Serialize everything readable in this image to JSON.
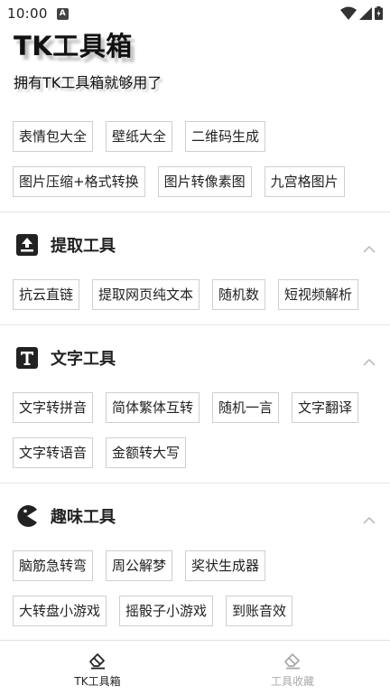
{
  "status_bar": {
    "time": "10:00",
    "notification_badge": "A"
  },
  "header": {
    "title": "TK工具箱",
    "subtitle": "拥有TK工具箱就够用了"
  },
  "top_tools": [
    {
      "label": "表情包大全"
    },
    {
      "label": "壁纸大全"
    },
    {
      "label": "二维码生成"
    },
    {
      "label": "图片压缩+格式转换"
    },
    {
      "label": "图片转像素图"
    },
    {
      "label": "九宫格图片"
    }
  ],
  "sections": [
    {
      "title": "提取工具",
      "icon": "upload-box-icon",
      "tools": [
        {
          "label": "抗云直链"
        },
        {
          "label": "提取网页纯文本"
        },
        {
          "label": "随机数"
        },
        {
          "label": "短视频解析"
        }
      ]
    },
    {
      "title": "文字工具",
      "icon": "text-box-icon",
      "tools": [
        {
          "label": "文字转拼音"
        },
        {
          "label": "简体繁体互转"
        },
        {
          "label": "随机一言"
        },
        {
          "label": "文字翻译"
        },
        {
          "label": "文字转语音"
        },
        {
          "label": "金额转大写"
        }
      ]
    },
    {
      "title": "趣味工具",
      "icon": "pacman-icon",
      "tools": [
        {
          "label": "脑筋急转弯"
        },
        {
          "label": "周公解梦"
        },
        {
          "label": "奖状生成器"
        },
        {
          "label": "大转盘小游戏"
        },
        {
          "label": "摇骰子小游戏"
        },
        {
          "label": "到账音效"
        }
      ]
    }
  ],
  "bottom_nav": [
    {
      "label": "TK工具箱",
      "icon": "eraser-icon",
      "active": true
    },
    {
      "label": "工具收藏",
      "icon": "eraser-icon",
      "active": false
    }
  ],
  "colors": {
    "accent": "#222222",
    "chip_border": "#cfcfcf",
    "inactive": "#aaaaaa"
  }
}
